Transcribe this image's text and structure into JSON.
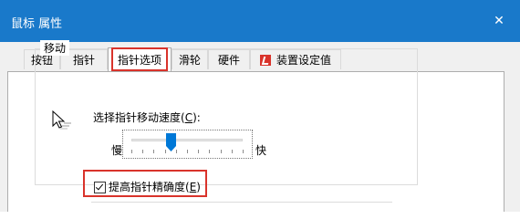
{
  "window": {
    "title": "鼠标 属性",
    "close_glyph": "✕"
  },
  "tabs": [
    {
      "label": "按钮"
    },
    {
      "label": "指针"
    },
    {
      "label": "指针选项"
    },
    {
      "label": "滑轮"
    },
    {
      "label": "硬件"
    },
    {
      "label": "装置设定值",
      "icon": "synaptics-icon"
    }
  ],
  "active_tab": "指针选项",
  "motion": {
    "group_title": "移动",
    "speed_label_prefix": "选择指针移动速度(",
    "speed_label_key": "C",
    "speed_label_suffix": "):",
    "slow_label": "慢",
    "fast_label": "快",
    "speed_position": 0.36
  },
  "enhance_precision": {
    "label_prefix": "提高指针精确度(",
    "label_key": "E",
    "label_suffix": ")",
    "checked": true
  },
  "colors": {
    "titlebar": "#1979ca",
    "highlight": "#d9332b",
    "thumb": "#0078d7"
  }
}
